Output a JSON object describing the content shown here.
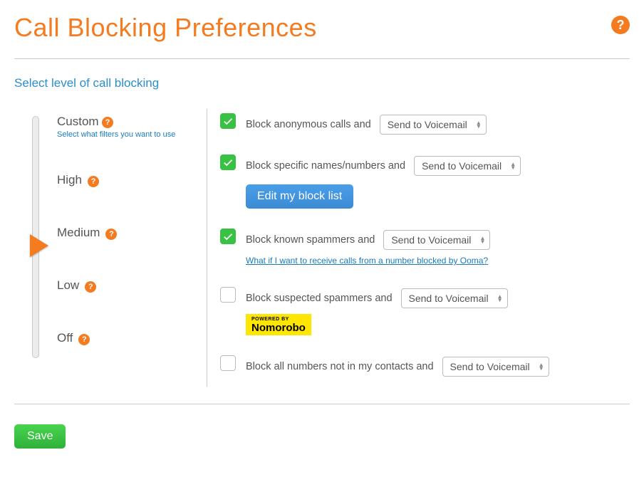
{
  "title": "Call Blocking Preferences",
  "section_label": "Select level of call blocking",
  "help_icon": "?",
  "levels": {
    "custom": {
      "label": "Custom",
      "sub": "Select what filters you want to use"
    },
    "high": {
      "label": "High"
    },
    "medium": {
      "label": "Medium"
    },
    "low": {
      "label": "Low"
    },
    "off": {
      "label": "Off"
    }
  },
  "selected_level": "medium",
  "select_options_default": "Send to Voicemail",
  "options": {
    "anonymous": {
      "checked": true,
      "text": "Block anonymous calls and",
      "action": "Send to Voicemail"
    },
    "specific": {
      "checked": true,
      "text": "Block specific names/numbers and",
      "action": "Send to Voicemail",
      "edit_button": "Edit my block list"
    },
    "known": {
      "checked": true,
      "text": "Block known spammers and",
      "action": "Send to Voicemail",
      "link": "What if I want to receive calls from a number blocked by Ooma?"
    },
    "suspected": {
      "checked": false,
      "text": "Block suspected spammers and",
      "action": "Send to Voicemail",
      "badge": {
        "powered_by": "POWERED BY",
        "name": "Nomorobo"
      }
    },
    "contacts": {
      "checked": false,
      "text": "Block all numbers not in my contacts and",
      "action": "Send to Voicemail"
    }
  },
  "save_label": "Save"
}
